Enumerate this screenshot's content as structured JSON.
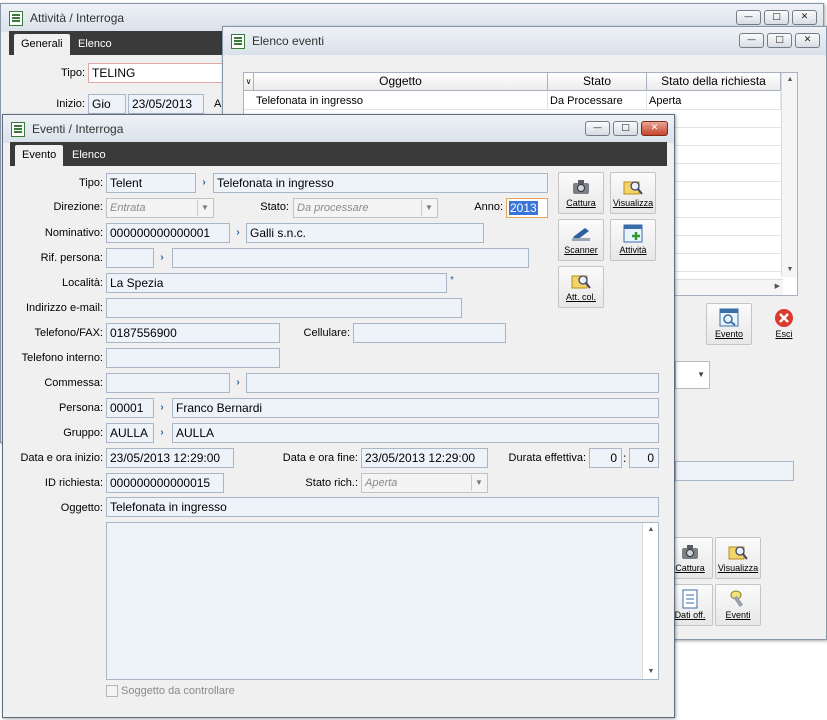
{
  "window_attivita": {
    "title": "Attività / Interroga",
    "tabs": [
      "Generali",
      "Elenco"
    ],
    "tipo_label": "Tipo:",
    "tipo_value": "TELING",
    "inizio_label": "Inizio:",
    "inizio_day": "Gio",
    "inizio_date": "23/05/2013",
    "inizio_suffix": "A"
  },
  "window_elenco": {
    "title": "Elenco eventi",
    "columns": [
      "Oggetto",
      "Stato",
      "Stato della richiesta"
    ],
    "rows": [
      {
        "oggetto": "Telefonata in ingresso",
        "stato": "Da Processare",
        "stato_richiesta": "Aperta"
      }
    ],
    "buttons": {
      "evento": "Evento",
      "esci": "Esci"
    },
    "bottom_buttons": {
      "cattura": "Cattura",
      "visualizza": "Visualizza",
      "dati_off": "Dati off.",
      "eventi": "Eventi"
    }
  },
  "window_eventi": {
    "title": "Eventi / Interroga",
    "tabs": [
      "Evento",
      "Elenco"
    ],
    "labels": {
      "tipo": "Tipo:",
      "direzione": "Direzione:",
      "stato": "Stato:",
      "anno": "Anno:",
      "nominativo": "Nominativo:",
      "rif_persona": "Rif. persona:",
      "localita": "Località:",
      "email": "Indirizzo e-mail:",
      "telefono_fax": "Telefono/FAX:",
      "cellulare": "Cellulare:",
      "telefono_interno": "Telefono interno:",
      "commessa": "Commessa:",
      "persona": "Persona:",
      "gruppo": "Gruppo:",
      "data_inizio": "Data e ora inizio:",
      "data_fine": "Data e ora fine:",
      "durata": "Durata effettiva:",
      "id_richiesta": "ID richiesta:",
      "stato_rich": "Stato  rich.:",
      "oggetto": "Oggetto:"
    },
    "values": {
      "tipo_code": "Telent",
      "tipo_desc": "Telefonata in ingresso",
      "direzione": "Entrata",
      "stato": "Da processare",
      "anno": "2013",
      "nominativo_code": "000000000000001",
      "nominativo_desc": "Galli s.n.c.",
      "rif_persona_code": "",
      "rif_persona_desc": "",
      "localita": "La Spezia",
      "email": "",
      "telefono_fax": "0187556900",
      "cellulare": "",
      "telefono_interno": "",
      "commessa_code": "",
      "commessa_desc": "",
      "persona_code": "00001",
      "persona_desc": "Franco  Bernardi",
      "gruppo_code": "AULLA",
      "gruppo_desc": "AULLA",
      "data_inizio": "23/05/2013 12:29:00",
      "data_fine": "23/05/2013 12:29:00",
      "durata_h": "0",
      "durata_sep": ":",
      "durata_m": "0",
      "id_richiesta": "000000000000015",
      "stato_rich": "Aperta",
      "oggetto": "Telefonata in ingresso",
      "note": ""
    },
    "checkbox_soggetto": "Soggetto da controllare",
    "buttons": {
      "cattura": "Cattura",
      "visualizza": "Visualizza",
      "scanner": "Scanner",
      "attivita": "Attività",
      "att_col": "Att. col."
    }
  }
}
